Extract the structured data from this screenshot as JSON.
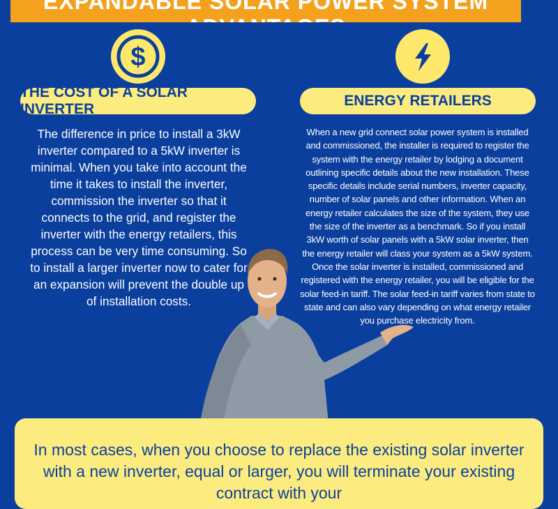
{
  "banner": {
    "title": "EXPANDABLE SOLAR POWER SYSTEM ADVANTAGES"
  },
  "left": {
    "icon": "dollar-icon",
    "heading": "THE COST OF A SOLAR INVERTER",
    "body": "The difference in price to install a 3kW inverter compared to a 5kW inverter is minimal. When you take into account the time it takes to install the inverter, commission the inverter so that it connects to the grid, and register the inverter with the energy retailers, this process can be very time consuming. So to install a larger inverter now to cater for an expansion will prevent the double up of installation costs."
  },
  "right": {
    "icon": "lightning-bolt-icon",
    "heading": "ENERGY RETAILERS",
    "body": "When a new grid connect solar power system is installed and commissioned, the installer is required to register the system with the energy retailer by lodging a document outlining specific details about the new installation. These specific details include serial numbers, inverter capacity, number of solar panels and other information. When an energy retailer calculates the size of the system, they use the size of the inverter as a benchmark. So if you install 3kW worth of solar panels with a 5kW solar inverter, then the energy retailer will class your system as a 5kW system. Once the solar inverter is installed, commissioned and registered with the energy retailer, you will be eligible for the solar feed-in tariff. The solar feed-in tariff varies from state to state and can also vary depending on what energy retailer you purchase electricity from."
  },
  "bottom": {
    "text": "In most cases, when you choose to replace the existing solar inverter with a new inverter, equal or larger, you will terminate your existing contract with your"
  },
  "colors": {
    "background": "#0b3f9e",
    "banner": "#f4a11d",
    "accent_yellow": "#fcec7f",
    "icon_yellow": "#fde86c"
  }
}
